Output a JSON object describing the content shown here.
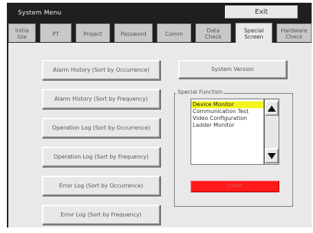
{
  "window": {
    "title": "System Menu",
    "exit_label": "Exit"
  },
  "tabs": [
    {
      "label": "Initia\nlize",
      "active": false
    },
    {
      "label": "PT",
      "active": false
    },
    {
      "label": "Project",
      "active": false
    },
    {
      "label": "Password",
      "active": false
    },
    {
      "label": "Comm",
      "active": false
    },
    {
      "label": "Data\nCheck",
      "active": false
    },
    {
      "label": "Special\nScreen",
      "active": true
    },
    {
      "label": "Hardware\nCheck",
      "active": false
    }
  ],
  "left_buttons": [
    "Alarm History (Sort by Occurrence)",
    "Alarm History (Sort by Frequency)",
    "Operation Log (Sort by Occurrence)",
    "Operation Log (Sort by Frequency)",
    "Error Log (Sort by Occurrence)",
    "Error Log (Sort by Frequency)"
  ],
  "system_version_label": "System Version",
  "special_function": {
    "legend": "Special Function",
    "items": [
      "Device Monitor",
      "Communication Test",
      "Video Configuration",
      "Ladder Monitor"
    ],
    "selected_index": 0,
    "start_label": "START"
  },
  "colors": {
    "frame": "#1f1f22",
    "panel": "#e9e9e9",
    "selection": "#f5f51e",
    "start_button": "#ff1a1a"
  },
  "icons": {
    "scroll_up": "triangle-up-icon",
    "scroll_down": "triangle-down-icon"
  }
}
